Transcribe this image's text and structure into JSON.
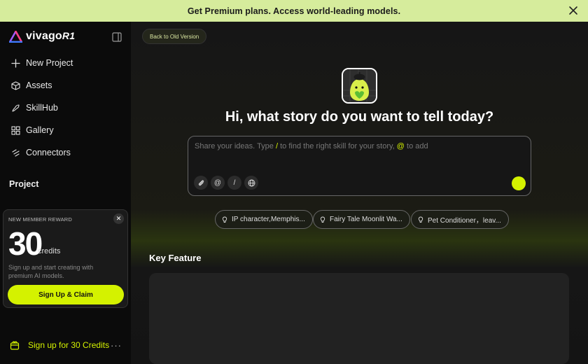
{
  "banner": {
    "text": "Get Premium plans. Access world-leading models.",
    "close_icon": "close-icon"
  },
  "sidebar": {
    "logo_text": "vivago",
    "logo_suffix": "R1",
    "items": [
      {
        "label": "New Project",
        "icon": "plus-icon"
      },
      {
        "label": "Assets",
        "icon": "cube-icon"
      },
      {
        "label": "SkillHub",
        "icon": "skill-icon"
      },
      {
        "label": "Gallery",
        "icon": "grid-icon"
      },
      {
        "label": "Connectors",
        "icon": "connector-icon"
      }
    ],
    "project_title": "Project",
    "signup_text": "Sign up for 30 Credits",
    "more": "···"
  },
  "reward": {
    "tag": "NEW MEMBER REWARD",
    "amount": "30",
    "unit": "credits",
    "description": "Sign up and start creating with premium AI models.",
    "button": "Sign Up & Claim",
    "close": "✕"
  },
  "main": {
    "old_version": "Back to Old Version",
    "headline": "Hi, what story do you want to tell today?",
    "prompt_part1": "Share your ideas. Type ",
    "prompt_slash": "/",
    "prompt_part2": " to find the right skill for your story, ",
    "prompt_at": "@",
    "prompt_part3": " to add",
    "tools": [
      "@",
      "/"
    ],
    "chips": [
      "IP character,Memphis...",
      "Fairy Tale Moonlit Wa...",
      "Pet Conditioner，leav..."
    ],
    "key_feature": "Key Feature"
  },
  "colors": {
    "accent": "#d4f200",
    "banner_bg": "#d6ec9c"
  }
}
